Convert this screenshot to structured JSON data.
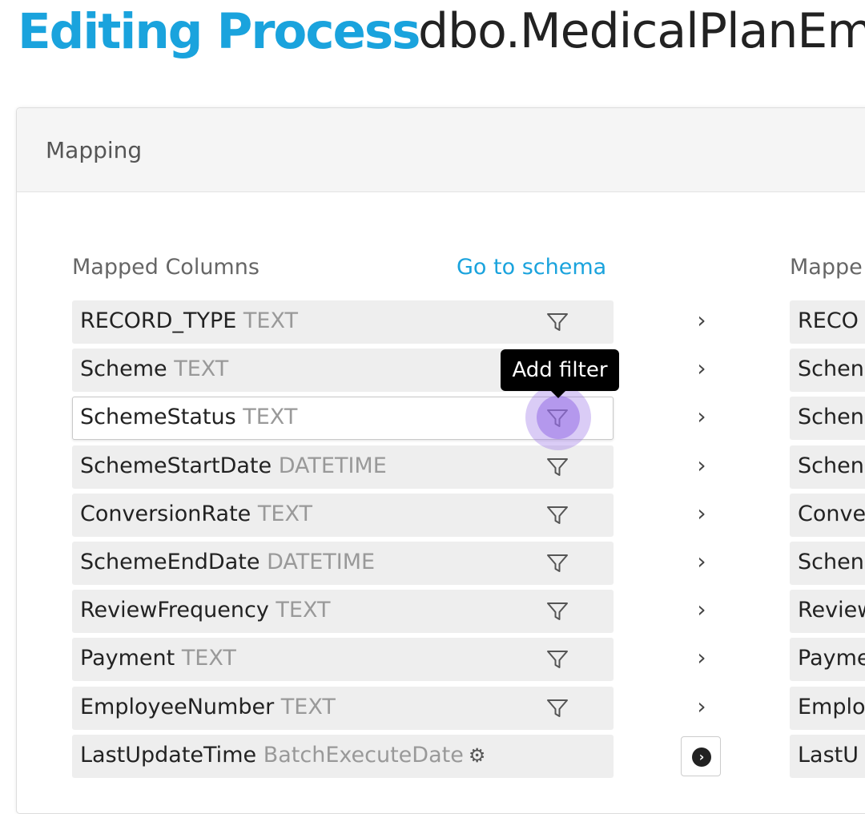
{
  "header": {
    "title_accent": "Editing Process",
    "title_object": "dbo.MedicalPlanEm"
  },
  "mapping_panel": {
    "title": "Mapping",
    "left_column_label": "Mapped Columns",
    "schema_link": "Go to schema",
    "right_column_label": "Mappe"
  },
  "tooltip": "Add filter",
  "rows": [
    {
      "name": "RECORD_TYPE",
      "type": "TEXT",
      "target": "RECO"
    },
    {
      "name": "Scheme",
      "type": "TEXT",
      "target": "Schen"
    },
    {
      "name": "SchemeStatus",
      "type": "TEXT",
      "target": "Schen"
    },
    {
      "name": "SchemeStartDate",
      "type": "DATETIME",
      "target": "Schen"
    },
    {
      "name": "ConversionRate",
      "type": "TEXT",
      "target": "Conve"
    },
    {
      "name": "SchemeEndDate",
      "type": "DATETIME",
      "target": "Schen"
    },
    {
      "name": "ReviewFrequency",
      "type": "TEXT",
      "target": "Review"
    },
    {
      "name": "Payment",
      "type": "TEXT",
      "target": "Payme"
    },
    {
      "name": "EmployeeNumber",
      "type": "TEXT",
      "target": "Emplo"
    },
    {
      "name": "LastUpdateTime",
      "type": "BatchExecuteDate",
      "target": "LastU"
    }
  ],
  "icons": {
    "filter": "filter-funnel-icon",
    "mapping_arrow": "chevron-right-icon",
    "settings": "gear-icon",
    "batch_action": "arrow-circle-right-icon"
  },
  "colors": {
    "accent": "#1aa3dd",
    "type_text": "#999999",
    "row_bg": "#eeeeee",
    "click_highlight": "#966ee6"
  }
}
